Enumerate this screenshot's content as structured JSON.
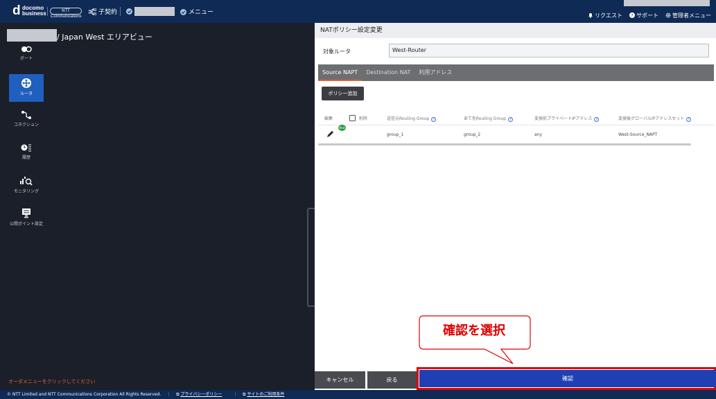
{
  "header": {
    "logo_top": "docomo",
    "logo_bottom": "business",
    "ntt_logo": "NTT Communications",
    "sub_contract": "子契約",
    "menu": "メニュー",
    "right_links": [
      "リクエスト",
      "サポート",
      "管理者メニュー"
    ]
  },
  "breadcrumb": "/ Japan West エリアビュー",
  "sidebar": {
    "items": [
      {
        "label": "ポート",
        "icon": "port-icon"
      },
      {
        "label": "ルータ",
        "icon": "router-icon",
        "active": true
      },
      {
        "label": "コネクション",
        "icon": "connection-icon"
      },
      {
        "label": "履歴",
        "icon": "history-icon"
      },
      {
        "label": "モニタリング",
        "icon": "monitoring-icon"
      },
      {
        "label": "公開ポイント設定",
        "icon": "public-point-icon"
      }
    ]
  },
  "order_hint": "オーダメニューをクリックしてください",
  "panel": {
    "title": "NATポリシー設定変更",
    "router_label": "対象ルータ",
    "router_value": "West-Router",
    "tabs": [
      "Source NAPT",
      "Destination NAT",
      "利用アドレス"
    ],
    "add_button": "ポリシー追加",
    "columns": {
      "edit": "編集",
      "delete": "削除",
      "src_group": "送信元Routing Group",
      "dst_group": "あて先Routing Group",
      "private_ip": "変換前プライベートIPアドレス",
      "global_ip_set": "変換後グローバルIPアドレスセット"
    },
    "rows": [
      {
        "badge": "New",
        "src_group": "group_1",
        "dst_group": "group_2",
        "private_ip": "any",
        "global_ip_set": "West-Source_NAPT"
      }
    ],
    "cancel_button": "キャンセル",
    "back_button": "戻る",
    "confirm_button": "確認",
    "callout": "確認を選択"
  },
  "footer": {
    "copyright": "© NTT Limited and NTT Communications Corporation All Rights Reserved.",
    "privacy": "プライバシーポリシー",
    "terms": "サイトのご利用条件"
  },
  "colors": {
    "header_bg": "#0e2a55",
    "active_nav": "#1f5fbf",
    "confirm": "#1f3fb2",
    "highlight": "#e00000",
    "tab_accent": "#e06530"
  }
}
